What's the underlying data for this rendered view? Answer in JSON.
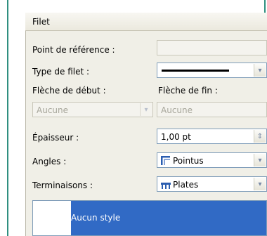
{
  "section": {
    "title": "Filet"
  },
  "rows": {
    "ref_point": {
      "label": "Point de référence :",
      "value": ""
    },
    "line_type": {
      "label": "Type de filet :"
    },
    "start_arrow": {
      "label": "Flèche de début :",
      "value": "Aucune"
    },
    "end_arrow": {
      "label": "Flèche de fin :",
      "value": "Aucune"
    },
    "thickness": {
      "label": "Épaisseur :",
      "value": "1,00 pt"
    },
    "angles": {
      "label": "Angles :",
      "value": "Pointus"
    },
    "endings": {
      "label": "Terminaisons :",
      "value": "Plates"
    }
  },
  "style_list": {
    "selected": "Aucun style"
  },
  "colors": {
    "selection": "#316ac5",
    "border_accent": "#2f8f80"
  },
  "icons": {
    "dropdown": "chevron-down-icon",
    "spinner": "spinner-arrows-icon",
    "angles": "miter-join-icon",
    "endings": "butt-cap-icon"
  }
}
